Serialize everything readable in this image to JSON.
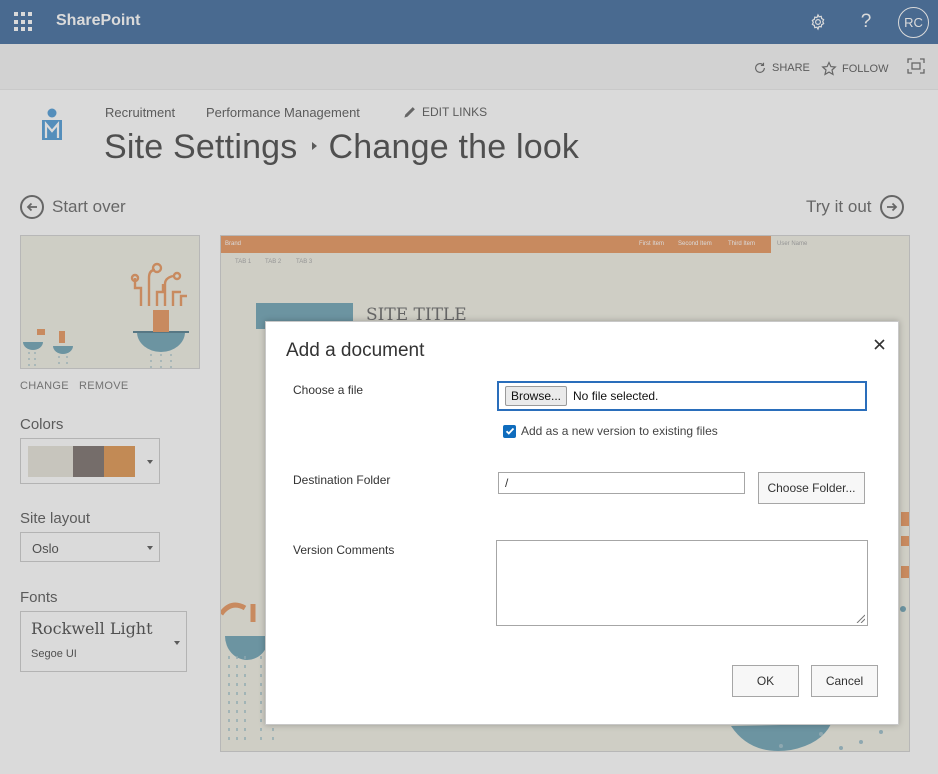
{
  "suitebar": {
    "app_name": "SharePoint",
    "avatar_initials": "RC",
    "bg_color": "#2a5a93"
  },
  "ribbon": {
    "share_label": "SHARE",
    "follow_label": "FOLLOW"
  },
  "header": {
    "nav_links": [
      "Recruitment",
      "Performance Management"
    ],
    "edit_links_label": "EDIT LINKS",
    "breadcrumb_parent": "Site Settings",
    "breadcrumb_current": "Change the look"
  },
  "left_pane": {
    "start_over_label": "Start over",
    "change_label": "CHANGE",
    "remove_label": "REMOVE",
    "colors_label": "Colors",
    "color_swatches": [
      "#e4e1d4",
      "#6a5f5a",
      "#dc8a3c"
    ],
    "site_layout_label": "Site layout",
    "site_layout_value": "Oslo",
    "fonts_label": "Fonts",
    "heading_font": "Rockwell Light",
    "body_font": "Segoe UI"
  },
  "preview": {
    "try_it_out_label": "Try it out",
    "brand_text": "Brand",
    "nav_items": [
      "First Item",
      "Second Item",
      "Third Item"
    ],
    "user_name": "User Name",
    "tabs": [
      "TAB 1",
      "TAB 2",
      "TAB 3"
    ],
    "site_title": "SITE TITLE",
    "accent_color": "#e5894b"
  },
  "dialog": {
    "title": "Add a document",
    "choose_file_label": "Choose a file",
    "browse_label": "Browse...",
    "file_status": "No file selected.",
    "new_version_label": "Add as a new version to existing files",
    "new_version_checked": true,
    "destination_label": "Destination Folder",
    "destination_value": "/",
    "choose_folder_label": "Choose Folder...",
    "version_comments_label": "Version Comments",
    "ok_label": "OK",
    "cancel_label": "Cancel"
  }
}
